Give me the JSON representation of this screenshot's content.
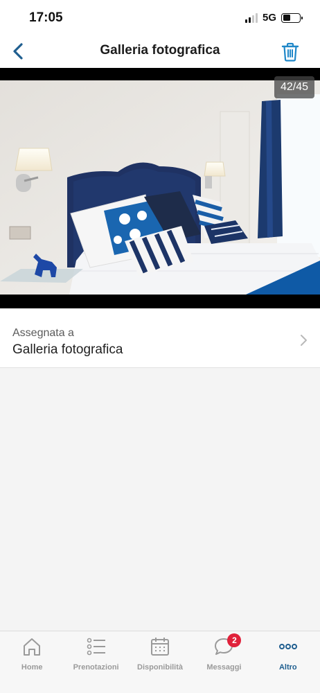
{
  "status_bar": {
    "time": "17:05",
    "network": "5G"
  },
  "header": {
    "title": "Galleria fotografica",
    "back_icon": "chevron-left-icon",
    "delete_icon": "trash-icon"
  },
  "photo": {
    "counter": "42/45",
    "subject": "hotel bedroom with blue headboard and pillows"
  },
  "assignment": {
    "caption": "Assegnata a",
    "value": "Galleria fotografica"
  },
  "tabs": [
    {
      "label": "Home",
      "icon": "home-icon",
      "active": false
    },
    {
      "label": "Prenotazioni",
      "icon": "list-icon",
      "active": false
    },
    {
      "label": "Disponibilità",
      "icon": "calendar-icon",
      "active": false
    },
    {
      "label": "Messaggi",
      "icon": "chat-icon",
      "active": false,
      "badge": "2"
    },
    {
      "label": "Altro",
      "icon": "more-icon",
      "active": true
    }
  ],
  "colors": {
    "accent": "#1f5e8f",
    "badge": "#e0213a",
    "inactive": "#9a9a9a"
  }
}
